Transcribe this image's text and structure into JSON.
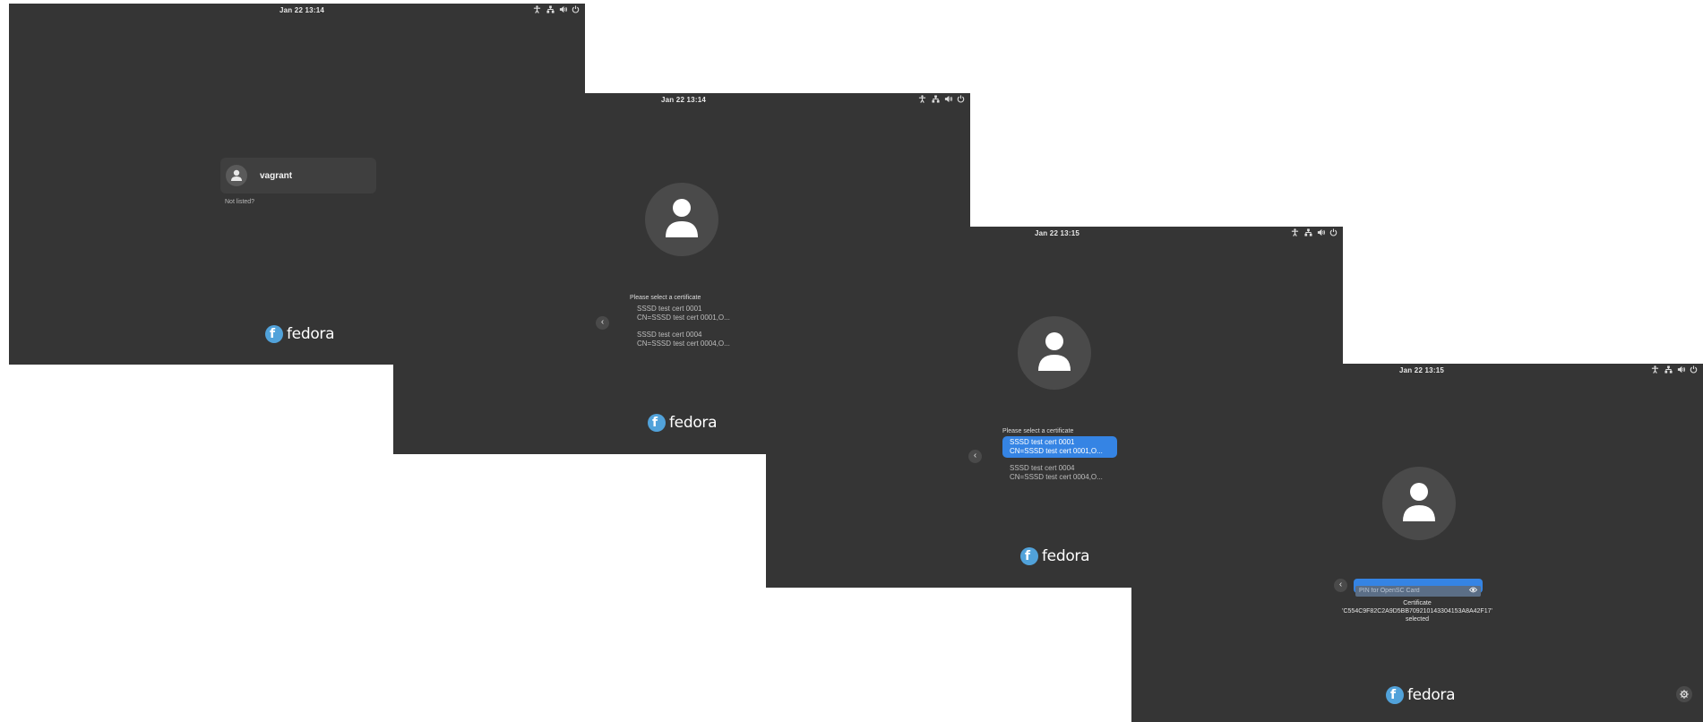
{
  "screens": [
    {
      "clock": "Jan 22  13:14",
      "user_name": "vagrant",
      "not_listed": "Not listed?",
      "logo": "fedora"
    },
    {
      "clock": "Jan 22  13:14",
      "prompt": "Please select a certificate",
      "certs": [
        {
          "name": "SSSD test cert 0001",
          "subject": "CN=SSSD test cert 0001,O..."
        },
        {
          "name": "SSSD test cert 0004",
          "subject": "CN=SSSD test cert 0004,O..."
        }
      ],
      "logo": "fedora"
    },
    {
      "clock": "Jan 22  13:15",
      "prompt": "Please select a certificate",
      "certs": [
        {
          "name": "SSSD test cert 0001",
          "subject": "CN=SSSD test cert 0001,O...",
          "selected": true
        },
        {
          "name": "SSSD test cert 0004",
          "subject": "CN=SSSD test cert 0004,O..."
        }
      ],
      "logo": "fedora"
    },
    {
      "clock": "Jan 22  13:15",
      "pin_placeholder": "PIN for OpenSC Card",
      "cert_msg_line1": "Certificate",
      "cert_msg_line2": "'C554C9F82C2A9D5BB709210143304153A8A42F17'",
      "cert_msg_line3": "selected",
      "logo": "fedora"
    }
  ],
  "icons": {
    "tray": [
      "accessibility-icon",
      "network-icon",
      "volume-icon",
      "power-icon"
    ],
    "avatar": "user-icon",
    "back": "chevron-left-icon",
    "reveal": "eye-icon",
    "settings": "gear-icon"
  },
  "colors": {
    "background": "#353535",
    "accent": "#3584e4",
    "fedora_blue": "#51a2da"
  }
}
